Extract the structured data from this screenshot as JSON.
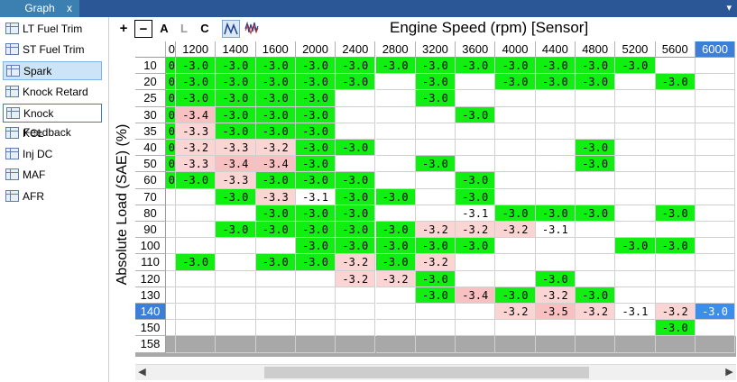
{
  "window": {
    "tab_title": "Graph",
    "tab_close": "x",
    "menu_glyph": "▾"
  },
  "sidebar": {
    "items": [
      {
        "label": "LT Fuel Trim",
        "state": ""
      },
      {
        "label": "ST Fuel Trim",
        "state": ""
      },
      {
        "label": "Spark",
        "state": "selected"
      },
      {
        "label": "Knock Retard",
        "state": ""
      },
      {
        "label": "Knock Feedback",
        "state": "boxed"
      },
      {
        "label": "KCL",
        "state": ""
      },
      {
        "label": "Inj DC",
        "state": ""
      },
      {
        "label": "MAF",
        "state": ""
      },
      {
        "label": "AFR",
        "state": ""
      }
    ]
  },
  "toolbar": {
    "zoom_in": "+",
    "zoom_out": "−",
    "btn_a": "A",
    "btn_l": "L",
    "btn_c": "C",
    "graph_icon": "line-graph-icon",
    "noise_icon": "noise-graph-icon"
  },
  "chart": {
    "title": "Engine Speed (rpm) [Sensor]",
    "ylabel": "Absolute Load (SAE) (%)",
    "cut_col_label": "0",
    "columns": [
      "1200",
      "1400",
      "1600",
      "2000",
      "2400",
      "2800",
      "3200",
      "3600",
      "4000",
      "4400",
      "4800",
      "5200",
      "5600",
      "6000"
    ],
    "selected_col": 13,
    "rows": [
      "10",
      "20",
      "25",
      "30",
      "35",
      "40",
      "50",
      "60",
      "70",
      "80",
      "90",
      "100",
      "110",
      "120",
      "130",
      "140",
      "150",
      "158"
    ],
    "selected_row": 15,
    "cells": [
      [
        "-3.0",
        "-3.0",
        "-3.0",
        "-3.0",
        "-3.0",
        "-3.0",
        "-3.0",
        "-3.0",
        "-3.0",
        "-3.0",
        "-3.0",
        "-3.0",
        "",
        ""
      ],
      [
        "-3.0",
        "-3.0",
        "-3.0",
        "-3.0",
        "-3.0",
        "",
        "-3.0",
        "",
        "-3.0",
        "-3.0",
        "-3.0",
        "",
        "-3.0",
        ""
      ],
      [
        "-3.0",
        "-3.0",
        "-3.0",
        "-3.0",
        "",
        "",
        "-3.0",
        "",
        "",
        "",
        "",
        "",
        "",
        ""
      ],
      [
        "-3.4",
        "-3.0",
        "-3.0",
        "-3.0",
        "",
        "",
        "",
        "-3.0",
        "",
        "",
        "",
        "",
        "",
        ""
      ],
      [
        "-3.3",
        "-3.0",
        "-3.0",
        "-3.0",
        "",
        "",
        "",
        "",
        "",
        "",
        "",
        "",
        "",
        ""
      ],
      [
        "-3.2",
        "-3.3",
        "-3.2",
        "-3.0",
        "-3.0",
        "",
        "",
        "",
        "",
        "",
        "-3.0",
        "",
        "",
        ""
      ],
      [
        "-3.3",
        "-3.4",
        "-3.4",
        "-3.0",
        "",
        "",
        "-3.0",
        "",
        "",
        "",
        "-3.0",
        "",
        "",
        ""
      ],
      [
        "-3.0",
        "-3.3",
        "-3.0",
        "-3.0",
        "-3.0",
        "",
        "",
        "-3.0",
        "",
        "",
        "",
        "",
        "",
        ""
      ],
      [
        "",
        "-3.0",
        "-3.3",
        "-3.1",
        "-3.0",
        "-3.0",
        "",
        "-3.0",
        "",
        "",
        "",
        "",
        "",
        ""
      ],
      [
        "",
        "",
        "-3.0",
        "-3.0",
        "-3.0",
        "",
        "",
        "-3.1",
        "-3.0",
        "-3.0",
        "-3.0",
        "",
        "-3.0",
        ""
      ],
      [
        "",
        "-3.0",
        "-3.0",
        "-3.0",
        "-3.0",
        "-3.0",
        "-3.2",
        "-3.2",
        "-3.2",
        "-3.1",
        "",
        "",
        "",
        ""
      ],
      [
        "",
        "",
        "",
        "-3.0",
        "-3.0",
        "-3.0",
        "-3.0",
        "-3.0",
        "",
        "",
        "",
        "-3.0",
        "-3.0",
        ""
      ],
      [
        "-3.0",
        "",
        "-3.0",
        "-3.0",
        "-3.2",
        "-3.0",
        "-3.2",
        "",
        "",
        "",
        "",
        "",
        "",
        ""
      ],
      [
        "",
        "",
        "",
        "",
        "-3.2",
        "-3.2",
        "-3.0",
        "",
        "",
        "-3.0",
        "",
        "",
        "",
        ""
      ],
      [
        "",
        "",
        "",
        "",
        "",
        "",
        "-3.0",
        "-3.4",
        "-3.0",
        "-3.2",
        "-3.0",
        "",
        "",
        ""
      ],
      [
        "",
        "",
        "",
        "",
        "",
        "",
        "",
        "",
        "-3.2",
        "-3.5",
        "-3.2",
        "-3.1",
        "-3.2",
        "-3.0"
      ],
      [
        "",
        "",
        "",
        "",
        "",
        "",
        "",
        "",
        "",
        "",
        "",
        "",
        "-3.0",
        ""
      ],
      [
        "",
        "",
        "",
        "",
        "",
        "",
        "",
        "",
        "",
        "",
        "",
        "",
        "",
        ""
      ]
    ],
    "cut_col_cells": [
      "0",
      "0",
      "0",
      "0",
      "0",
      "0",
      "0",
      "0",
      "",
      "",
      "",
      "",
      "",
      "",
      "",
      "",
      "",
      ""
    ],
    "colors": {
      "green": "#11ee11",
      "pink": "#fbd4d4",
      "pink_strong": "#f8c0c0",
      "selected": "#3c8ee8"
    }
  }
}
